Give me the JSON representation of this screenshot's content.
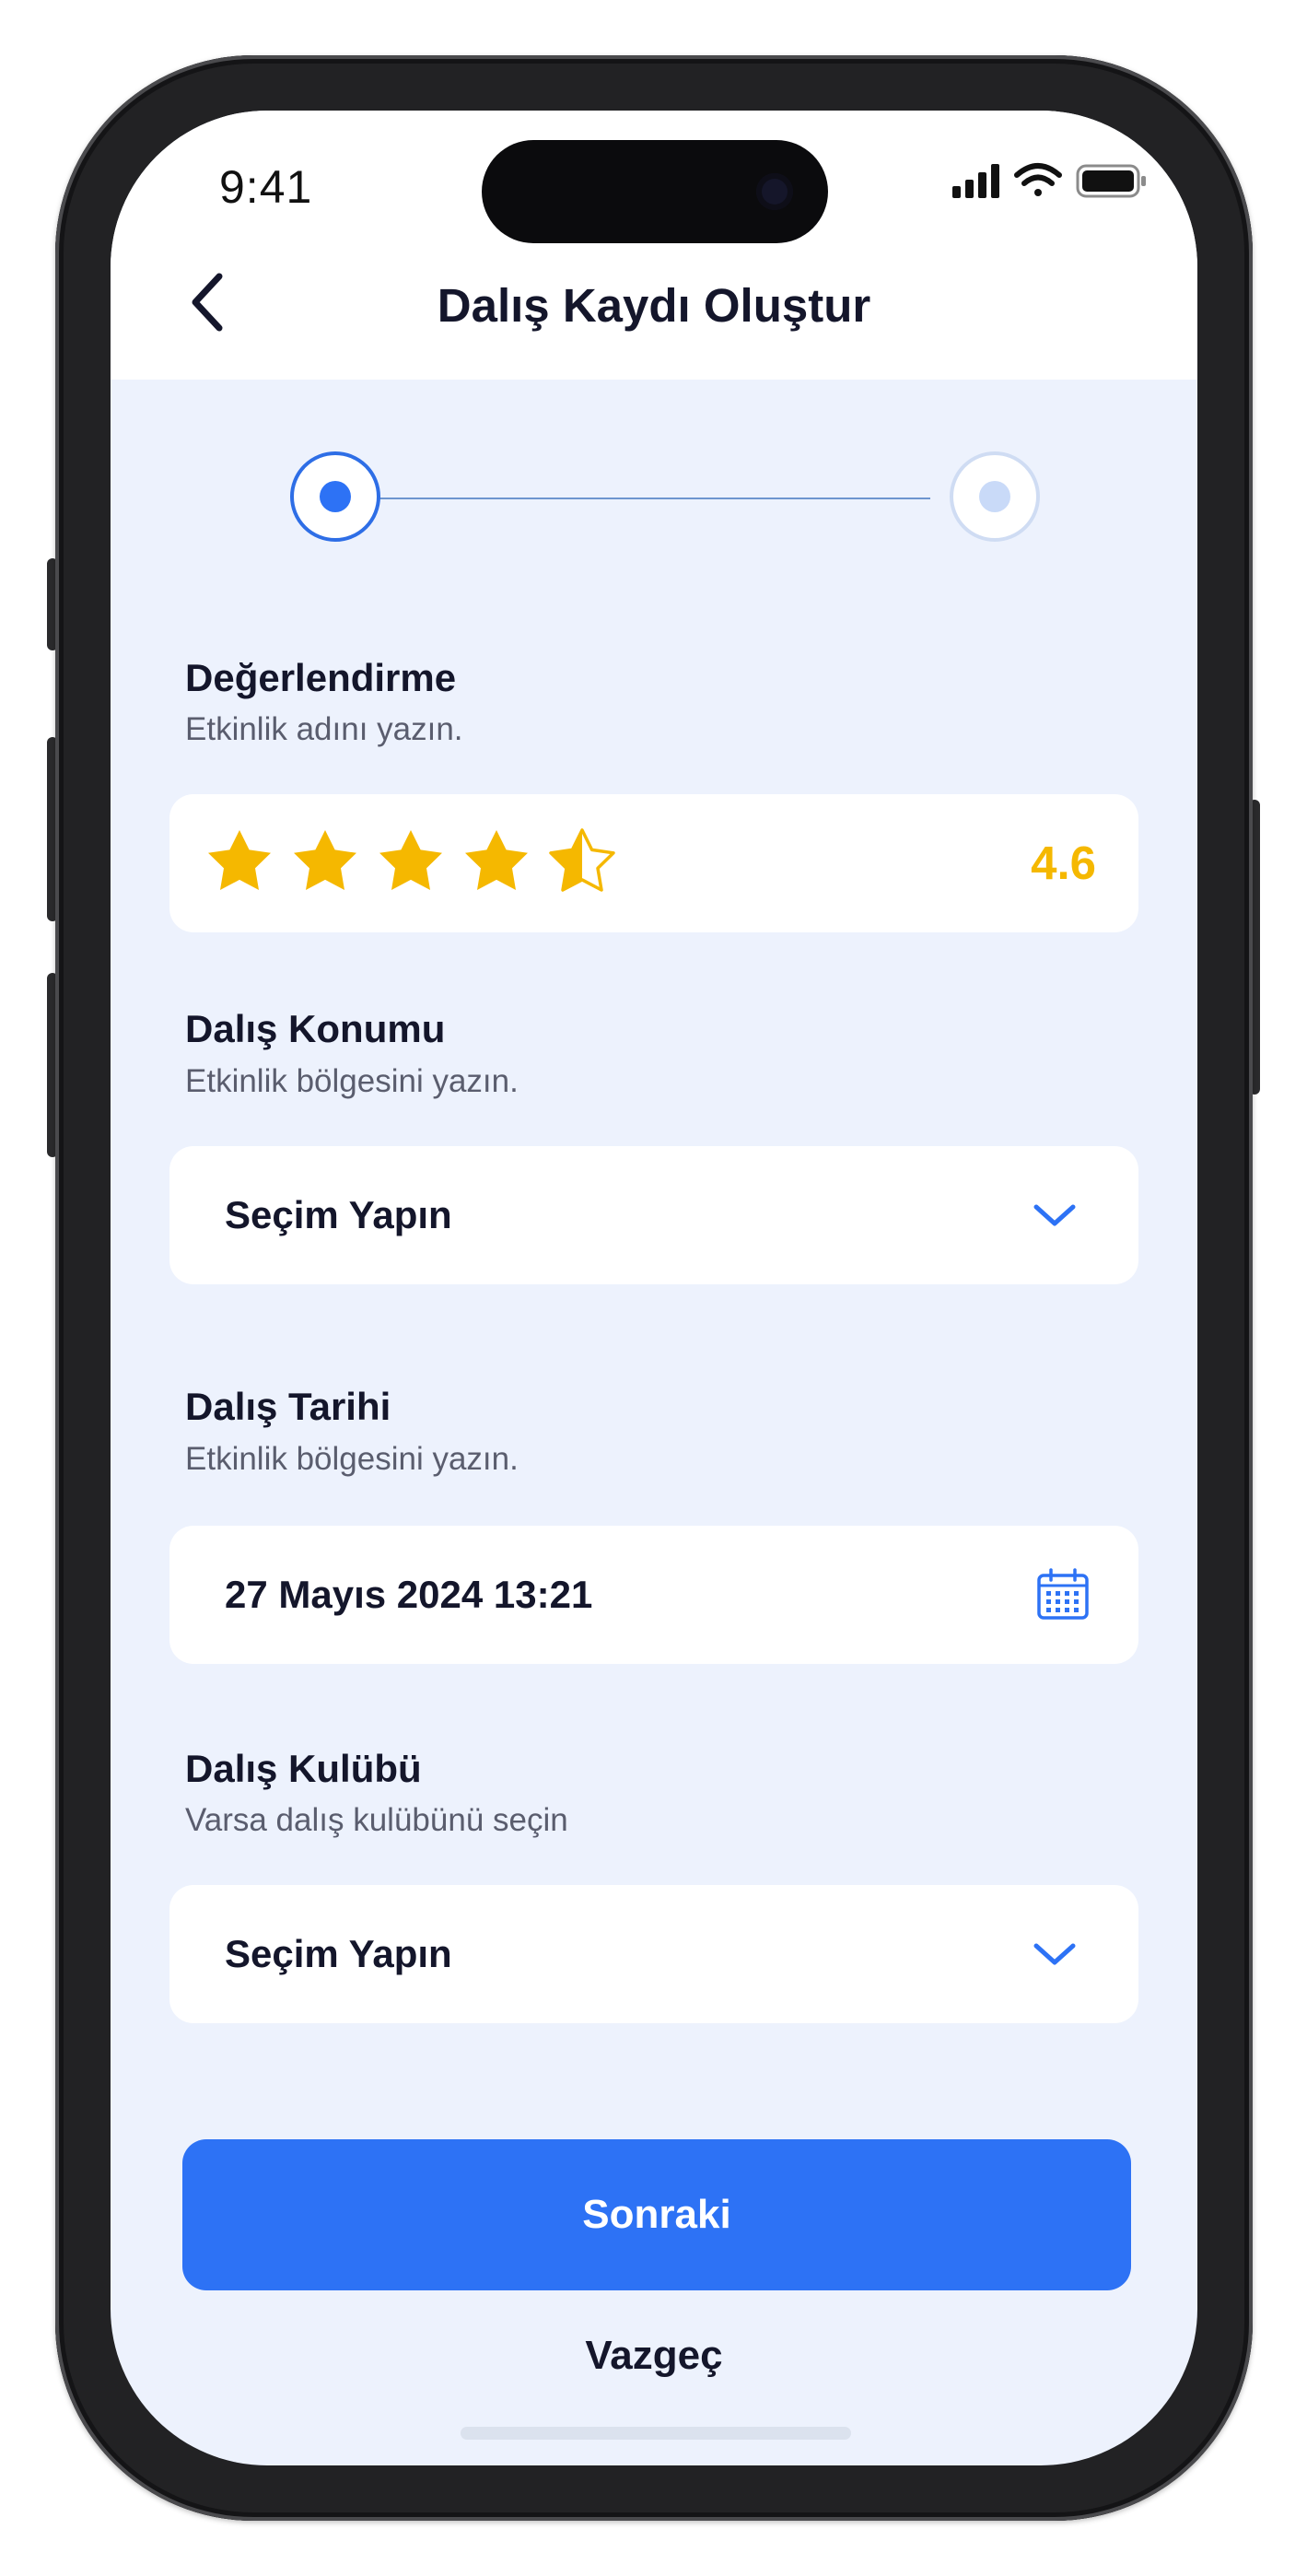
{
  "status_bar": {
    "time": "9:41",
    "icons": [
      "signal-icon",
      "wifi-icon",
      "battery-icon"
    ]
  },
  "header": {
    "title": "Dalış Kaydı Oluştur",
    "back_icon": "chevron-left-icon"
  },
  "stepper": {
    "total_steps": 2,
    "current_step": 1
  },
  "rating": {
    "label": "Değerlendirme",
    "hint": "Etkinlik adını yazın.",
    "value": "4.6",
    "max_stars": 5,
    "star_fill_level": 4.5
  },
  "location": {
    "label": "Dalış Konumu",
    "hint": "Etkinlik bölgesini yazın.",
    "selected": "Seçim Yapın",
    "icon": "chevron-down-icon"
  },
  "date": {
    "label": "Dalış Tarihi",
    "hint": "Etkinlik bölgesini yazın.",
    "value": "27 Mayıs 2024 13:21",
    "icon": "calendar-icon"
  },
  "club": {
    "label": "Dalış Kulübü",
    "hint": "Varsa dalış kulübünü seçin",
    "selected": "Seçim Yapın",
    "icon": "chevron-down-icon"
  },
  "actions": {
    "primary": "Sonraki",
    "secondary": "Vazgeç"
  },
  "colors": {
    "accent": "#2D72F5",
    "star": "#F5B800",
    "background": "#EDF2FD",
    "text": "#14162B"
  }
}
